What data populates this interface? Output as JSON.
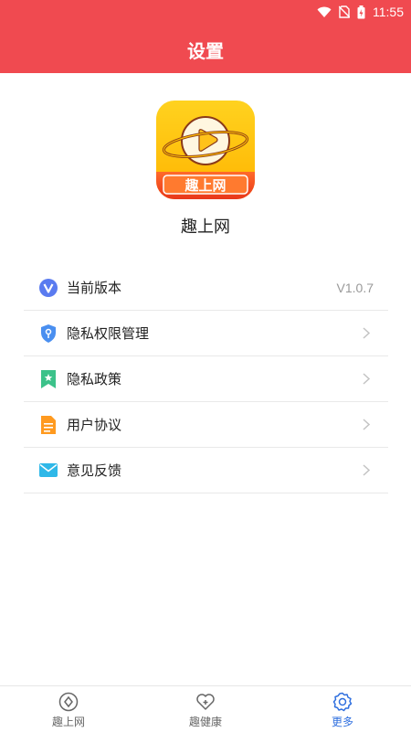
{
  "status_bar": {
    "time": "11:55"
  },
  "header": {
    "title": "设置"
  },
  "app": {
    "icon_text": "趣上网",
    "name": "趣上网"
  },
  "settings": [
    {
      "label": "当前版本",
      "value": "V1.0.7",
      "icon": "version-v-icon"
    },
    {
      "label": "隐私权限管理",
      "icon": "shield-key-icon"
    },
    {
      "label": "隐私政策",
      "icon": "bookmark-star-icon"
    },
    {
      "label": "用户协议",
      "icon": "document-icon"
    },
    {
      "label": "意见反馈",
      "icon": "mail-icon"
    }
  ],
  "tabs": [
    {
      "label": "趣上网",
      "icon": "compass-icon",
      "active": false
    },
    {
      "label": "趣健康",
      "icon": "heart-plus-icon",
      "active": false
    },
    {
      "label": "更多",
      "icon": "gear-icon",
      "active": true
    }
  ],
  "colors": {
    "header": "#f04a50",
    "accent": "#2f6fdf"
  }
}
